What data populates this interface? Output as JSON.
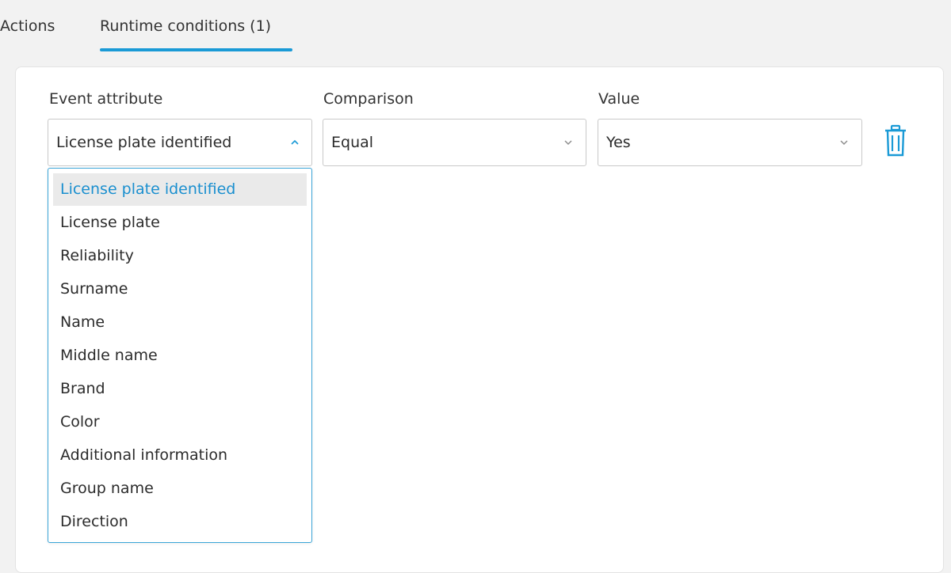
{
  "tabs": [
    {
      "label": "Actions"
    },
    {
      "label": "Runtime conditions (1)"
    }
  ],
  "active_tab": "Runtime conditions (1)",
  "accent_color": "#1a9ad6",
  "columns": {
    "attribute": "Event attribute",
    "comparison": "Comparison",
    "value": "Value"
  },
  "condition": {
    "attribute": "License plate identified",
    "comparison": "Equal",
    "value": "Yes"
  },
  "icons": {
    "attribute_chevron": "chevron-up-icon",
    "comparison_chevron": "chevron-down-icon",
    "value_chevron": "chevron-down-icon",
    "delete": "trash-icon"
  },
  "dropdown": {
    "items": [
      "License plate identified",
      "License plate",
      "Reliability",
      "Surname",
      "Name",
      "Middle name",
      "Brand",
      "Color",
      "Additional information",
      "Group name",
      "Direction"
    ],
    "selected": "License plate identified"
  }
}
